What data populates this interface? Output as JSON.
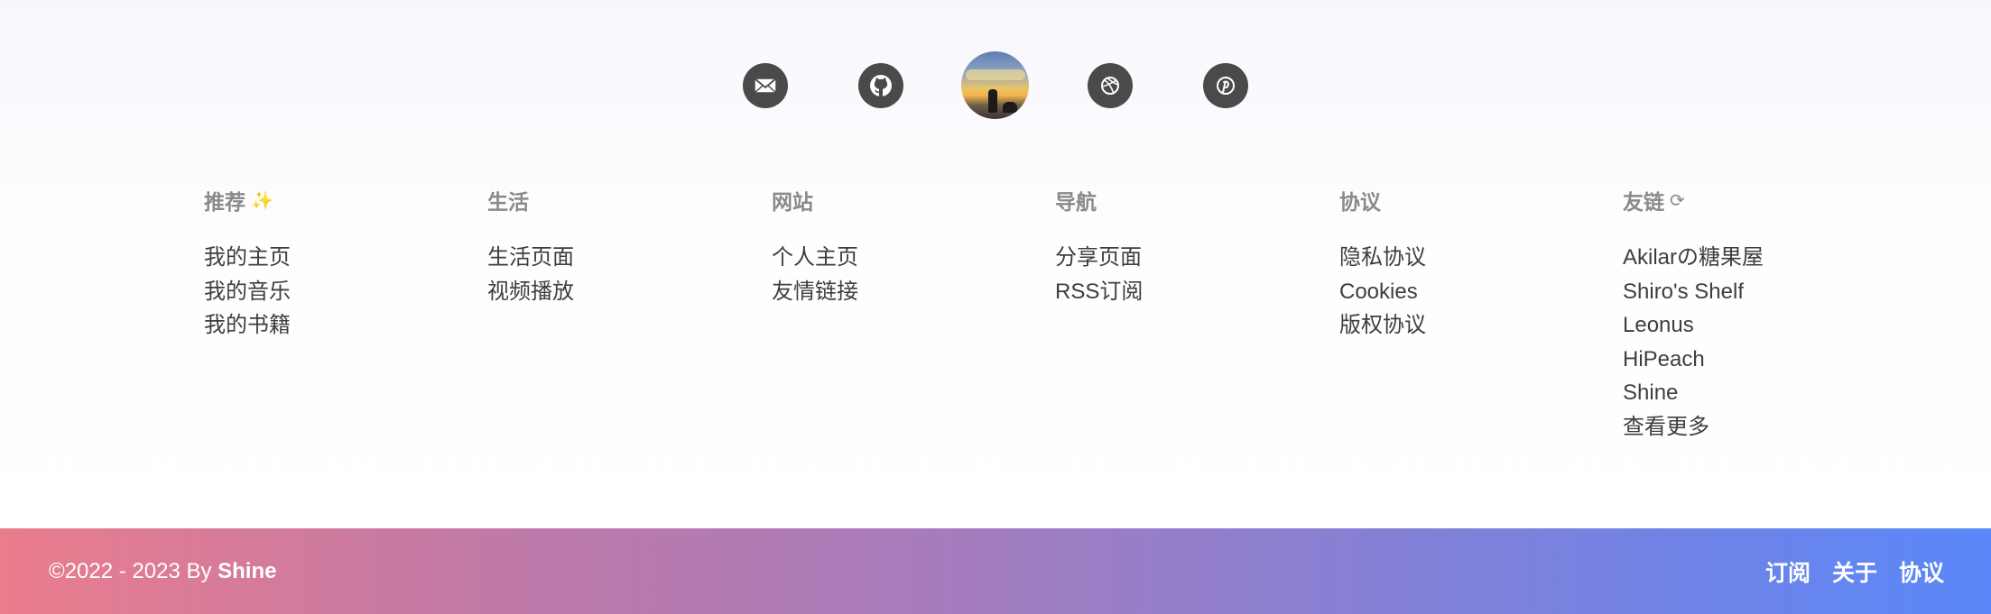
{
  "social": {
    "icons": [
      "email-icon",
      "github-icon",
      "avatar",
      "dribbble-icon",
      "pinterest-icon"
    ]
  },
  "columns": [
    {
      "title": "推荐",
      "title_emoji": "✨",
      "links": [
        "我的主页",
        "我的音乐",
        "我的书籍"
      ]
    },
    {
      "title": "生活",
      "links": [
        "生活页面",
        "视频播放"
      ]
    },
    {
      "title": "网站",
      "links": [
        "个人主页",
        "友情链接"
      ]
    },
    {
      "title": "导航",
      "links": [
        "分享页面",
        "RSS订阅"
      ]
    },
    {
      "title": "协议",
      "links": [
        "隐私协议",
        "Cookies",
        "版权协议"
      ]
    },
    {
      "title": "友链",
      "title_icon": "⟳",
      "links": [
        "Akilarの糖果屋",
        "Shiro's Shelf",
        "Leonus",
        "HiPeach",
        "Shine",
        "查看更多"
      ]
    }
  ],
  "footer": {
    "copyright_prefix": "©2022 - 2023 By ",
    "author": "Shine",
    "links": [
      "订阅",
      "关于",
      "协议"
    ],
    "gradient_start": "#ea7c8c",
    "gradient_end": "#5a88f9"
  }
}
